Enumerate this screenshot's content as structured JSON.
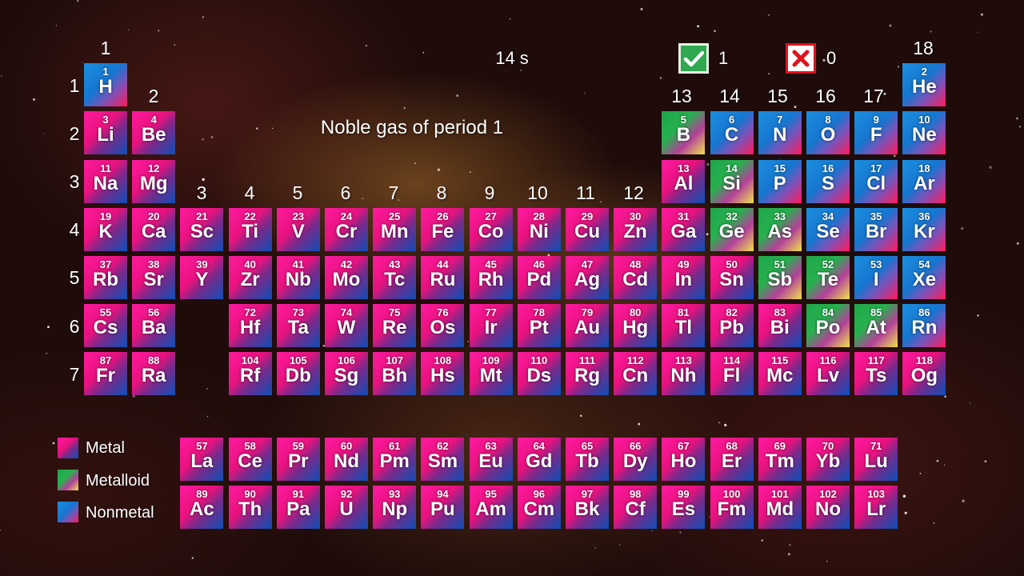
{
  "timer": "14 s",
  "question": "Noble gas of period 1",
  "score": {
    "correct": "1",
    "wrong": "0"
  },
  "colors": {
    "metal": "#e8127e",
    "metalloid": "#26b14e",
    "nonmetal": "#1676cf",
    "correct": "#2fa84f",
    "wrong": "#e0131d"
  },
  "icons": {
    "correct": "check-icon",
    "wrong": "cross-icon"
  },
  "group_numbers": [
    "1",
    "2",
    "3",
    "4",
    "5",
    "6",
    "7",
    "8",
    "9",
    "10",
    "11",
    "12",
    "13",
    "14",
    "15",
    "16",
    "17",
    "18"
  ],
  "period_numbers": [
    "1",
    "2",
    "3",
    "4",
    "5",
    "6",
    "7"
  ],
  "legend": [
    "Metal",
    "Metalloid",
    "Nonmetal"
  ],
  "elements": [
    {
      "n": 1,
      "s": "H",
      "t": "nonmetal"
    },
    {
      "n": 2,
      "s": "He",
      "t": "nonmetal"
    },
    {
      "n": 3,
      "s": "Li",
      "t": "metal"
    },
    {
      "n": 4,
      "s": "Be",
      "t": "metal"
    },
    {
      "n": 5,
      "s": "B",
      "t": "metalloid"
    },
    {
      "n": 6,
      "s": "C",
      "t": "nonmetal"
    },
    {
      "n": 7,
      "s": "N",
      "t": "nonmetal"
    },
    {
      "n": 8,
      "s": "O",
      "t": "nonmetal"
    },
    {
      "n": 9,
      "s": "F",
      "t": "nonmetal"
    },
    {
      "n": 10,
      "s": "Ne",
      "t": "nonmetal"
    },
    {
      "n": 11,
      "s": "Na",
      "t": "metal"
    },
    {
      "n": 12,
      "s": "Mg",
      "t": "metal"
    },
    {
      "n": 13,
      "s": "Al",
      "t": "metal"
    },
    {
      "n": 14,
      "s": "Si",
      "t": "metalloid"
    },
    {
      "n": 15,
      "s": "P",
      "t": "nonmetal"
    },
    {
      "n": 16,
      "s": "S",
      "t": "nonmetal"
    },
    {
      "n": 17,
      "s": "Cl",
      "t": "nonmetal"
    },
    {
      "n": 18,
      "s": "Ar",
      "t": "nonmetal"
    },
    {
      "n": 19,
      "s": "K",
      "t": "metal"
    },
    {
      "n": 20,
      "s": "Ca",
      "t": "metal"
    },
    {
      "n": 21,
      "s": "Sc",
      "t": "metal"
    },
    {
      "n": 22,
      "s": "Ti",
      "t": "metal"
    },
    {
      "n": 23,
      "s": "V",
      "t": "metal"
    },
    {
      "n": 24,
      "s": "Cr",
      "t": "metal"
    },
    {
      "n": 25,
      "s": "Mn",
      "t": "metal"
    },
    {
      "n": 26,
      "s": "Fe",
      "t": "metal"
    },
    {
      "n": 27,
      "s": "Co",
      "t": "metal"
    },
    {
      "n": 28,
      "s": "Ni",
      "t": "metal"
    },
    {
      "n": 29,
      "s": "Cu",
      "t": "metal"
    },
    {
      "n": 30,
      "s": "Zn",
      "t": "metal"
    },
    {
      "n": 31,
      "s": "Ga",
      "t": "metal"
    },
    {
      "n": 32,
      "s": "Ge",
      "t": "metalloid"
    },
    {
      "n": 33,
      "s": "As",
      "t": "metalloid"
    },
    {
      "n": 34,
      "s": "Se",
      "t": "nonmetal"
    },
    {
      "n": 35,
      "s": "Br",
      "t": "nonmetal"
    },
    {
      "n": 36,
      "s": "Kr",
      "t": "nonmetal"
    },
    {
      "n": 37,
      "s": "Rb",
      "t": "metal"
    },
    {
      "n": 38,
      "s": "Sr",
      "t": "metal"
    },
    {
      "n": 39,
      "s": "Y",
      "t": "metal"
    },
    {
      "n": 40,
      "s": "Zr",
      "t": "metal"
    },
    {
      "n": 41,
      "s": "Nb",
      "t": "metal"
    },
    {
      "n": 42,
      "s": "Mo",
      "t": "metal"
    },
    {
      "n": 43,
      "s": "Tc",
      "t": "metal"
    },
    {
      "n": 44,
      "s": "Ru",
      "t": "metal"
    },
    {
      "n": 45,
      "s": "Rh",
      "t": "metal"
    },
    {
      "n": 46,
      "s": "Pd",
      "t": "metal"
    },
    {
      "n": 47,
      "s": "Ag",
      "t": "metal"
    },
    {
      "n": 48,
      "s": "Cd",
      "t": "metal"
    },
    {
      "n": 49,
      "s": "In",
      "t": "metal"
    },
    {
      "n": 50,
      "s": "Sn",
      "t": "metal"
    },
    {
      "n": 51,
      "s": "Sb",
      "t": "metalloid"
    },
    {
      "n": 52,
      "s": "Te",
      "t": "metalloid"
    },
    {
      "n": 53,
      "s": "I",
      "t": "nonmetal"
    },
    {
      "n": 54,
      "s": "Xe",
      "t": "nonmetal"
    },
    {
      "n": 55,
      "s": "Cs",
      "t": "metal"
    },
    {
      "n": 56,
      "s": "Ba",
      "t": "metal"
    },
    {
      "n": 72,
      "s": "Hf",
      "t": "metal"
    },
    {
      "n": 73,
      "s": "Ta",
      "t": "metal"
    },
    {
      "n": 74,
      "s": "W",
      "t": "metal"
    },
    {
      "n": 75,
      "s": "Re",
      "t": "metal"
    },
    {
      "n": 76,
      "s": "Os",
      "t": "metal"
    },
    {
      "n": 77,
      "s": "Ir",
      "t": "metal"
    },
    {
      "n": 78,
      "s": "Pt",
      "t": "metal"
    },
    {
      "n": 79,
      "s": "Au",
      "t": "metal"
    },
    {
      "n": 80,
      "s": "Hg",
      "t": "metal"
    },
    {
      "n": 81,
      "s": "Tl",
      "t": "metal"
    },
    {
      "n": 82,
      "s": "Pb",
      "t": "metal"
    },
    {
      "n": 83,
      "s": "Bi",
      "t": "metal"
    },
    {
      "n": 84,
      "s": "Po",
      "t": "metalloid"
    },
    {
      "n": 85,
      "s": "At",
      "t": "metalloid"
    },
    {
      "n": 86,
      "s": "Rn",
      "t": "nonmetal"
    },
    {
      "n": 87,
      "s": "Fr",
      "t": "metal"
    },
    {
      "n": 88,
      "s": "Ra",
      "t": "metal"
    },
    {
      "n": 104,
      "s": "Rf",
      "t": "metal"
    },
    {
      "n": 105,
      "s": "Db",
      "t": "metal"
    },
    {
      "n": 106,
      "s": "Sg",
      "t": "metal"
    },
    {
      "n": 107,
      "s": "Bh",
      "t": "metal"
    },
    {
      "n": 108,
      "s": "Hs",
      "t": "metal"
    },
    {
      "n": 109,
      "s": "Mt",
      "t": "metal"
    },
    {
      "n": 110,
      "s": "Ds",
      "t": "metal"
    },
    {
      "n": 111,
      "s": "Rg",
      "t": "metal"
    },
    {
      "n": 112,
      "s": "Cn",
      "t": "metal"
    },
    {
      "n": 113,
      "s": "Nh",
      "t": "metal"
    },
    {
      "n": 114,
      "s": "Fl",
      "t": "metal"
    },
    {
      "n": 115,
      "s": "Mc",
      "t": "metal"
    },
    {
      "n": 116,
      "s": "Lv",
      "t": "metal"
    },
    {
      "n": 117,
      "s": "Ts",
      "t": "metal"
    },
    {
      "n": 118,
      "s": "Og",
      "t": "metal"
    },
    {
      "n": 57,
      "s": "La",
      "t": "metal"
    },
    {
      "n": 58,
      "s": "Ce",
      "t": "metal"
    },
    {
      "n": 59,
      "s": "Pr",
      "t": "metal"
    },
    {
      "n": 60,
      "s": "Nd",
      "t": "metal"
    },
    {
      "n": 61,
      "s": "Pm",
      "t": "metal"
    },
    {
      "n": 62,
      "s": "Sm",
      "t": "metal"
    },
    {
      "n": 63,
      "s": "Eu",
      "t": "metal"
    },
    {
      "n": 64,
      "s": "Gd",
      "t": "metal"
    },
    {
      "n": 65,
      "s": "Tb",
      "t": "metal"
    },
    {
      "n": 66,
      "s": "Dy",
      "t": "metal"
    },
    {
      "n": 67,
      "s": "Ho",
      "t": "metal"
    },
    {
      "n": 68,
      "s": "Er",
      "t": "metal"
    },
    {
      "n": 69,
      "s": "Tm",
      "t": "metal"
    },
    {
      "n": 70,
      "s": "Yb",
      "t": "metal"
    },
    {
      "n": 71,
      "s": "Lu",
      "t": "metal"
    },
    {
      "n": 89,
      "s": "Ac",
      "t": "metal"
    },
    {
      "n": 90,
      "s": "Th",
      "t": "metal"
    },
    {
      "n": 91,
      "s": "Pa",
      "t": "metal"
    },
    {
      "n": 92,
      "s": "U",
      "t": "metal"
    },
    {
      "n": 93,
      "s": "Np",
      "t": "metal"
    },
    {
      "n": 94,
      "s": "Pu",
      "t": "metal"
    },
    {
      "n": 95,
      "s": "Am",
      "t": "metal"
    },
    {
      "n": 96,
      "s": "Cm",
      "t": "metal"
    },
    {
      "n": 97,
      "s": "Bk",
      "t": "metal"
    },
    {
      "n": 98,
      "s": "Cf",
      "t": "metal"
    },
    {
      "n": 99,
      "s": "Es",
      "t": "metal"
    },
    {
      "n": 100,
      "s": "Fm",
      "t": "metal"
    },
    {
      "n": 101,
      "s": "Md",
      "t": "metal"
    },
    {
      "n": 102,
      "s": "No",
      "t": "metal"
    },
    {
      "n": 103,
      "s": "Lr",
      "t": "metal"
    }
  ]
}
